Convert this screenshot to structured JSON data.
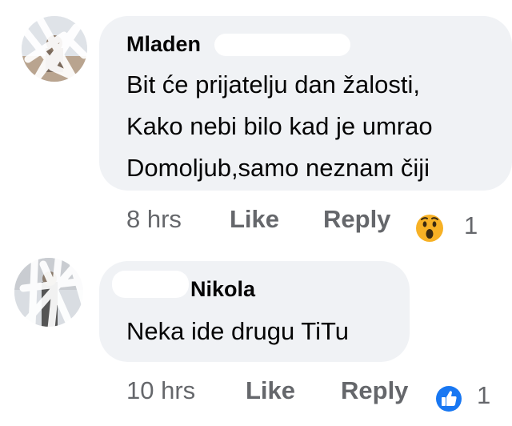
{
  "comments": [
    {
      "author": "Mladen",
      "text_lines": [
        "Bit će prijatelju dan žalosti,",
        "Kako nebi bilo kad je umrao",
        "Domoljub,samo neznam čiji"
      ],
      "time": "8 hrs",
      "like_label": "Like",
      "reply_label": "Reply",
      "reaction_icon": "wow-reaction-icon",
      "reaction_count": "1"
    },
    {
      "author": "Nikola",
      "text_lines": [
        "Neka ide drugu TiTu"
      ],
      "time": "10 hrs",
      "like_label": "Like",
      "reply_label": "Reply",
      "reaction_icon": "like-reaction-icon",
      "reaction_count": "1"
    }
  ],
  "colors": {
    "bubble": "#f0f2f5",
    "meta_text": "#65676b",
    "like_blue": "#1877f2",
    "wow_yellow": "#f7b125"
  }
}
